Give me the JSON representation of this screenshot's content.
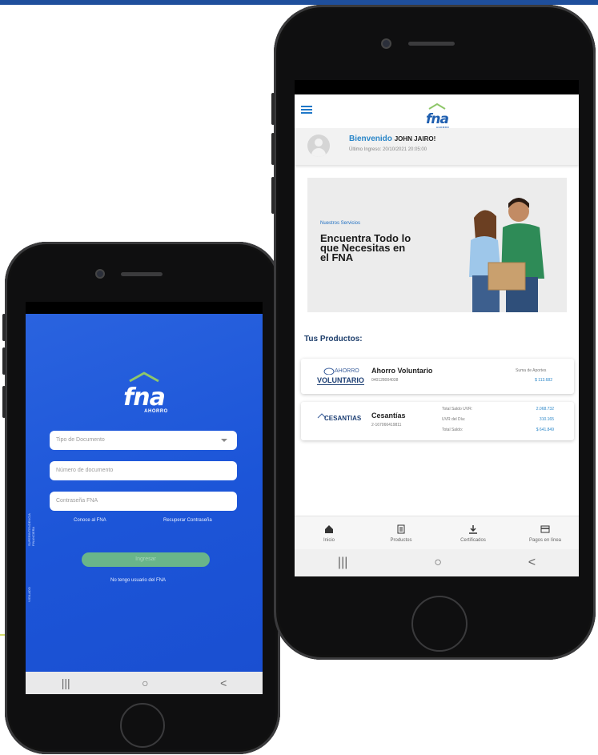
{
  "left_phone": {
    "brand": {
      "mark": "fna",
      "sub": "AHORRO"
    },
    "form": {
      "document_type_placeholder": "Tipo de Documento",
      "document_number_placeholder": "Número de documento",
      "password_placeholder": "Contraseña FNA"
    },
    "links": {
      "about": "Conoce al FNA",
      "recover": "Recuperar Contraseña",
      "not_user": "No tengo usuario del FNA"
    },
    "login_button": "Ingresar",
    "system_nav": {
      "recents": "|||",
      "home": "○",
      "back": "<"
    }
  },
  "right_phone": {
    "brand": {
      "mark": "fna",
      "sub": "AHORRO"
    },
    "welcome": {
      "greeting": "Bienvenido",
      "name": "JOHN JAIRO!",
      "last_login": "Último Ingreso: 20/10/2021 20:05:00"
    },
    "banner": {
      "kicker": "Nuestros Servicios",
      "headline": "Encuentra Todo lo que Necesitas en el FNA"
    },
    "products_title": "Tus Productos:",
    "products": [
      {
        "logo_top": "AHORRO",
        "logo_bottom": "VOLUNTARIO",
        "name": "Ahorro Voluntario",
        "number": "040128004038",
        "details": [
          {
            "label": "Suma de Aportes",
            "value": "$ 113.682"
          }
        ]
      },
      {
        "logo_text": "CESANTIAS",
        "name": "Cesantías",
        "number": "2-167066419811",
        "details": [
          {
            "label": "Total Saldo UVR:",
            "value": "2.068.732"
          },
          {
            "label": "UVR del Día:",
            "value": "310.165"
          },
          {
            "label": "Total Saldo:",
            "value": "$ 641.849"
          }
        ]
      }
    ],
    "bottom_nav": [
      {
        "label": "Inicio",
        "icon": "home-icon"
      },
      {
        "label": "Productos",
        "icon": "document-icon"
      },
      {
        "label": "Certificados",
        "icon": "download-icon"
      },
      {
        "label": "Pagos en línea",
        "icon": "card-icon"
      }
    ],
    "system_nav": {
      "recents": "|||",
      "home": "○",
      "back": "<"
    }
  },
  "colors": {
    "brand_blue": "#1f78c8",
    "login_gradient_start": "#2a63df",
    "login_gradient_end": "#1a4fd1",
    "login_button": "#69b58a",
    "roof_green": "#8fc76a",
    "top_bar": "#1f4f9c"
  }
}
